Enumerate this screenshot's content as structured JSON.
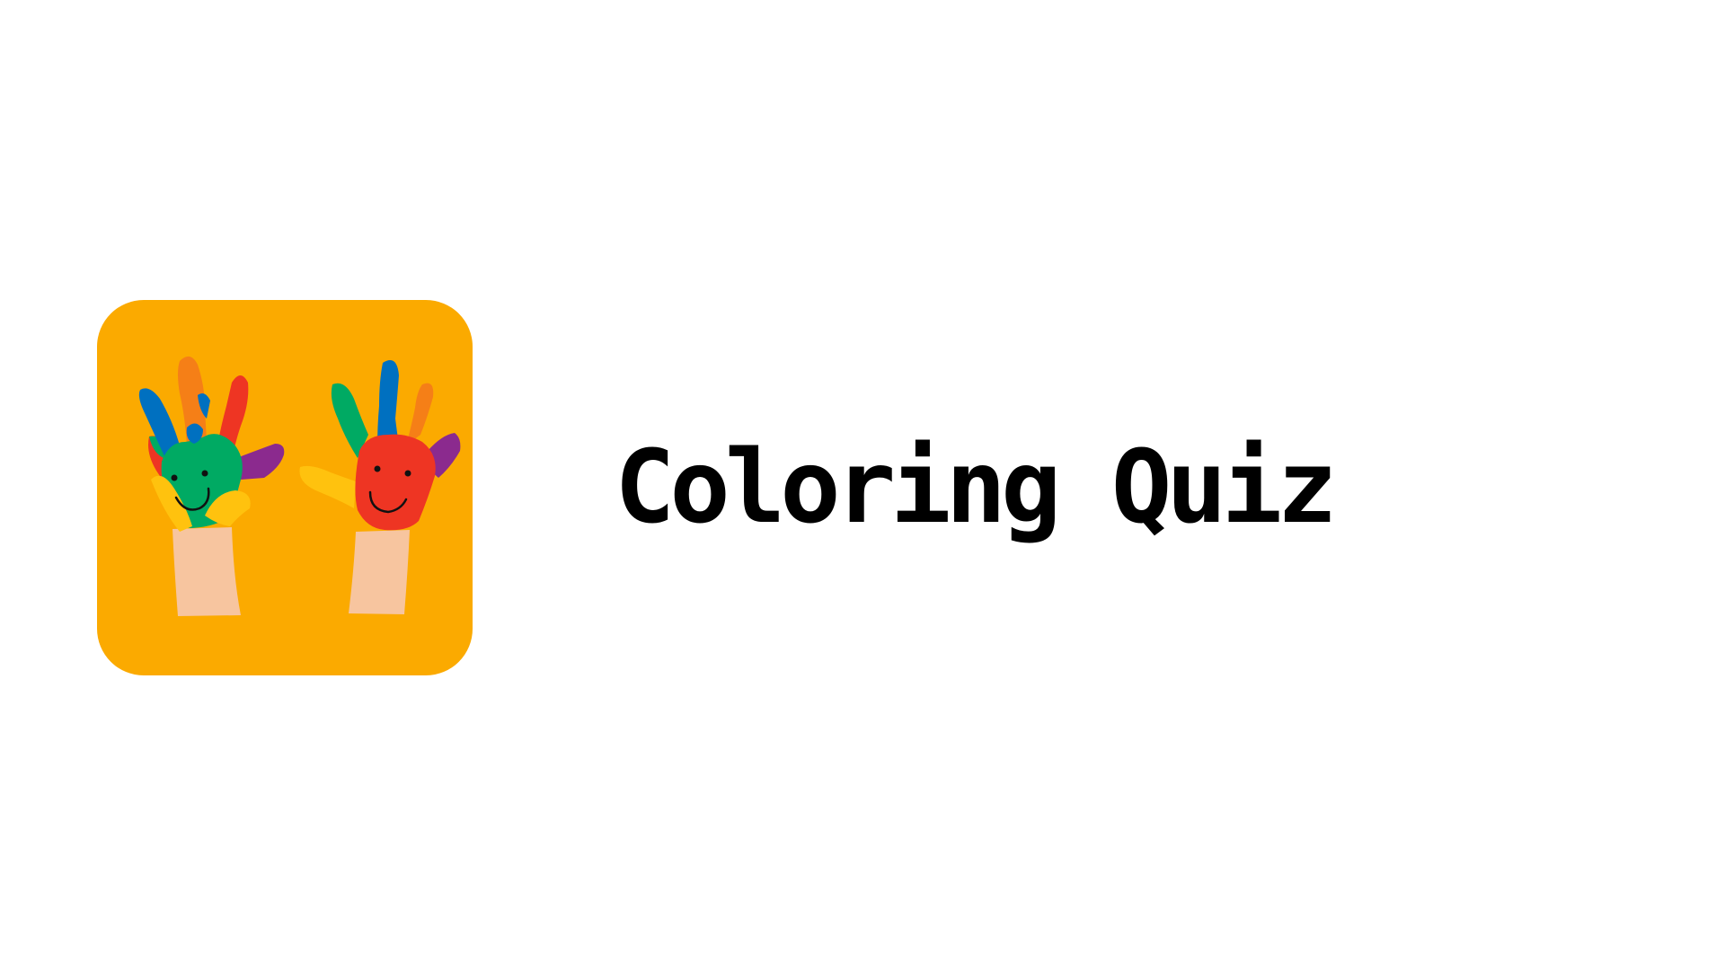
{
  "app": {
    "title": "Coloring Quiz",
    "icon": "painted-hands-icon"
  },
  "colors": {
    "background": "#ffffff",
    "tile": "#FBAA00",
    "title_text": "#000000",
    "skin": "#F7C59F",
    "green": "#00AA63",
    "red": "#EE3523",
    "blue": "#0070C0",
    "orange": "#F57F17",
    "purple": "#8B2A8E",
    "yellow": "#FFC20E"
  }
}
